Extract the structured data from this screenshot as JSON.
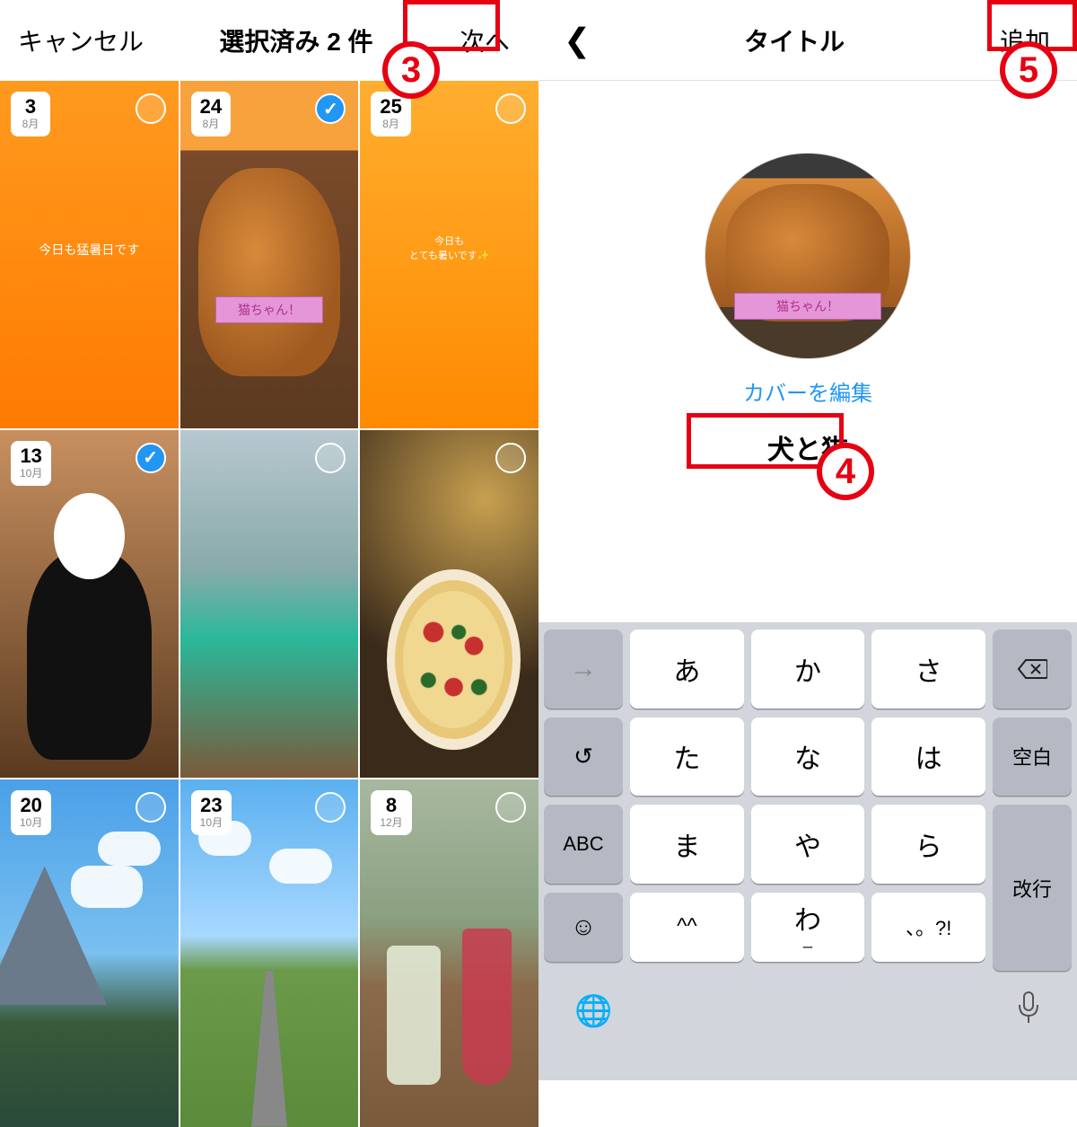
{
  "left": {
    "cancel": "キャンセル",
    "title": "選択済み 2 件",
    "next": "次へ",
    "stories": [
      {
        "day": "3",
        "month": "8月",
        "text": "今日も猛暑日です",
        "checked": false,
        "bg": "bg-orange"
      },
      {
        "day": "24",
        "month": "8月",
        "text": "",
        "label": "猫ちゃん！",
        "checked": true,
        "bg": "bg-cat"
      },
      {
        "day": "25",
        "month": "8月",
        "text": "今日も\nとても暑いです✨",
        "checked": false,
        "bg": "bg-orange2"
      },
      {
        "day": "13",
        "month": "10月",
        "text": "",
        "checked": true,
        "bg": "bg-dog"
      },
      {
        "day": "",
        "month": "",
        "text": "",
        "checked": false,
        "bg": "bg-onsen"
      },
      {
        "day": "",
        "month": "",
        "text": "",
        "checked": false,
        "bg": "bg-pizza-room"
      },
      {
        "day": "20",
        "month": "10月",
        "text": "",
        "checked": false,
        "bg": "bg-fuji"
      },
      {
        "day": "23",
        "month": "10月",
        "text": "",
        "checked": false,
        "bg": "bg-road"
      },
      {
        "day": "8",
        "month": "12月",
        "text": "",
        "checked": false,
        "bg": "bg-drinks"
      }
    ]
  },
  "right": {
    "header_title": "タイトル",
    "add": "追加",
    "edit_cover": "カバーを編集",
    "cover_label": "猫ちゃん！",
    "title_value": "犬と猫"
  },
  "keyboard": {
    "rows": [
      [
        "→",
        "あ",
        "か",
        "さ",
        "⌫"
      ],
      [
        "↺",
        "た",
        "な",
        "は",
        "空白"
      ],
      [
        "ABC",
        "ま",
        "や",
        "ら",
        "改行"
      ],
      [
        "☺",
        "^^",
        "わ",
        "、。?!",
        ""
      ]
    ],
    "wa_sub": "ー"
  },
  "annotations": {
    "step3": "3",
    "step4": "4",
    "step5": "5"
  }
}
